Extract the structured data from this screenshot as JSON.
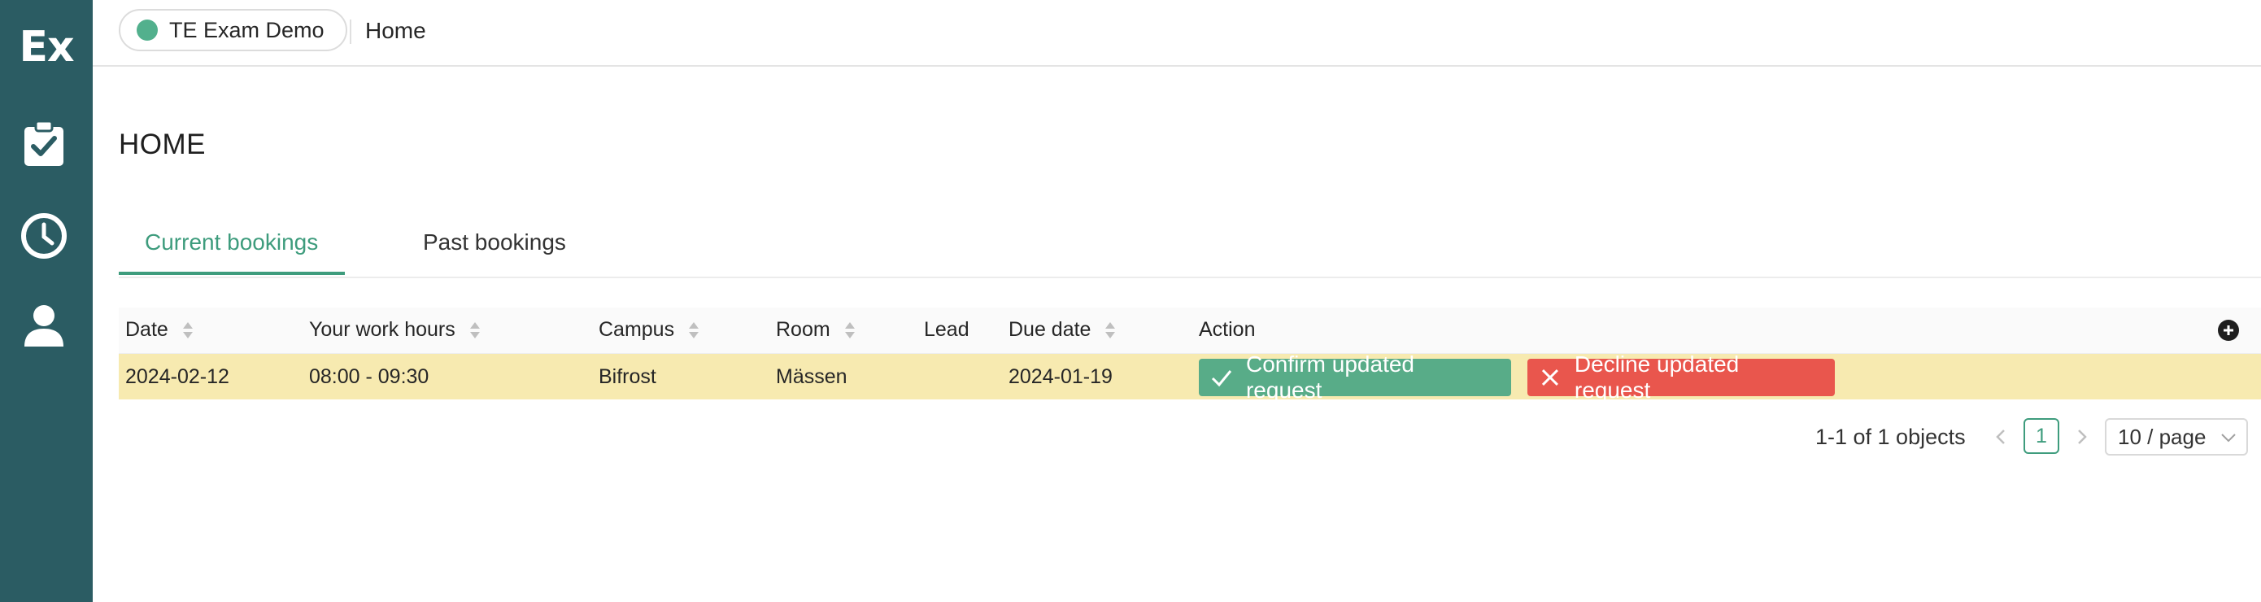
{
  "sidebar": {
    "logo": "Ex",
    "items": [
      {
        "icon": "clipboard-check-icon"
      },
      {
        "icon": "clock-icon"
      },
      {
        "icon": "user-icon"
      }
    ]
  },
  "topbar": {
    "environment": "TE Exam Demo",
    "breadcrumb": "Home"
  },
  "page": {
    "title": "HOME"
  },
  "tabs": [
    {
      "label": "Current bookings",
      "active": true
    },
    {
      "label": "Past bookings",
      "active": false
    }
  ],
  "table": {
    "columns": [
      "Date",
      "Your work hours",
      "Campus",
      "Room",
      "Lead",
      "Due date",
      "Action"
    ],
    "rows": [
      {
        "date": "2024-02-12",
        "work_hours": "08:00 - 09:30",
        "campus": "Bifrost",
        "room": "Mässen",
        "lead": "",
        "due_date": "2024-01-19",
        "confirm_label": "Confirm updated request",
        "decline_label": "Decline updated request"
      }
    ]
  },
  "pagination": {
    "total": "1-1 of 1 objects",
    "current_page": "1",
    "page_size": "10 / page"
  },
  "colors": {
    "sidebar": "#2b5c63",
    "accent": "#3e9c7d",
    "row_highlight": "#f7eab0",
    "confirm": "#58ac88",
    "decline": "#e9564d"
  }
}
